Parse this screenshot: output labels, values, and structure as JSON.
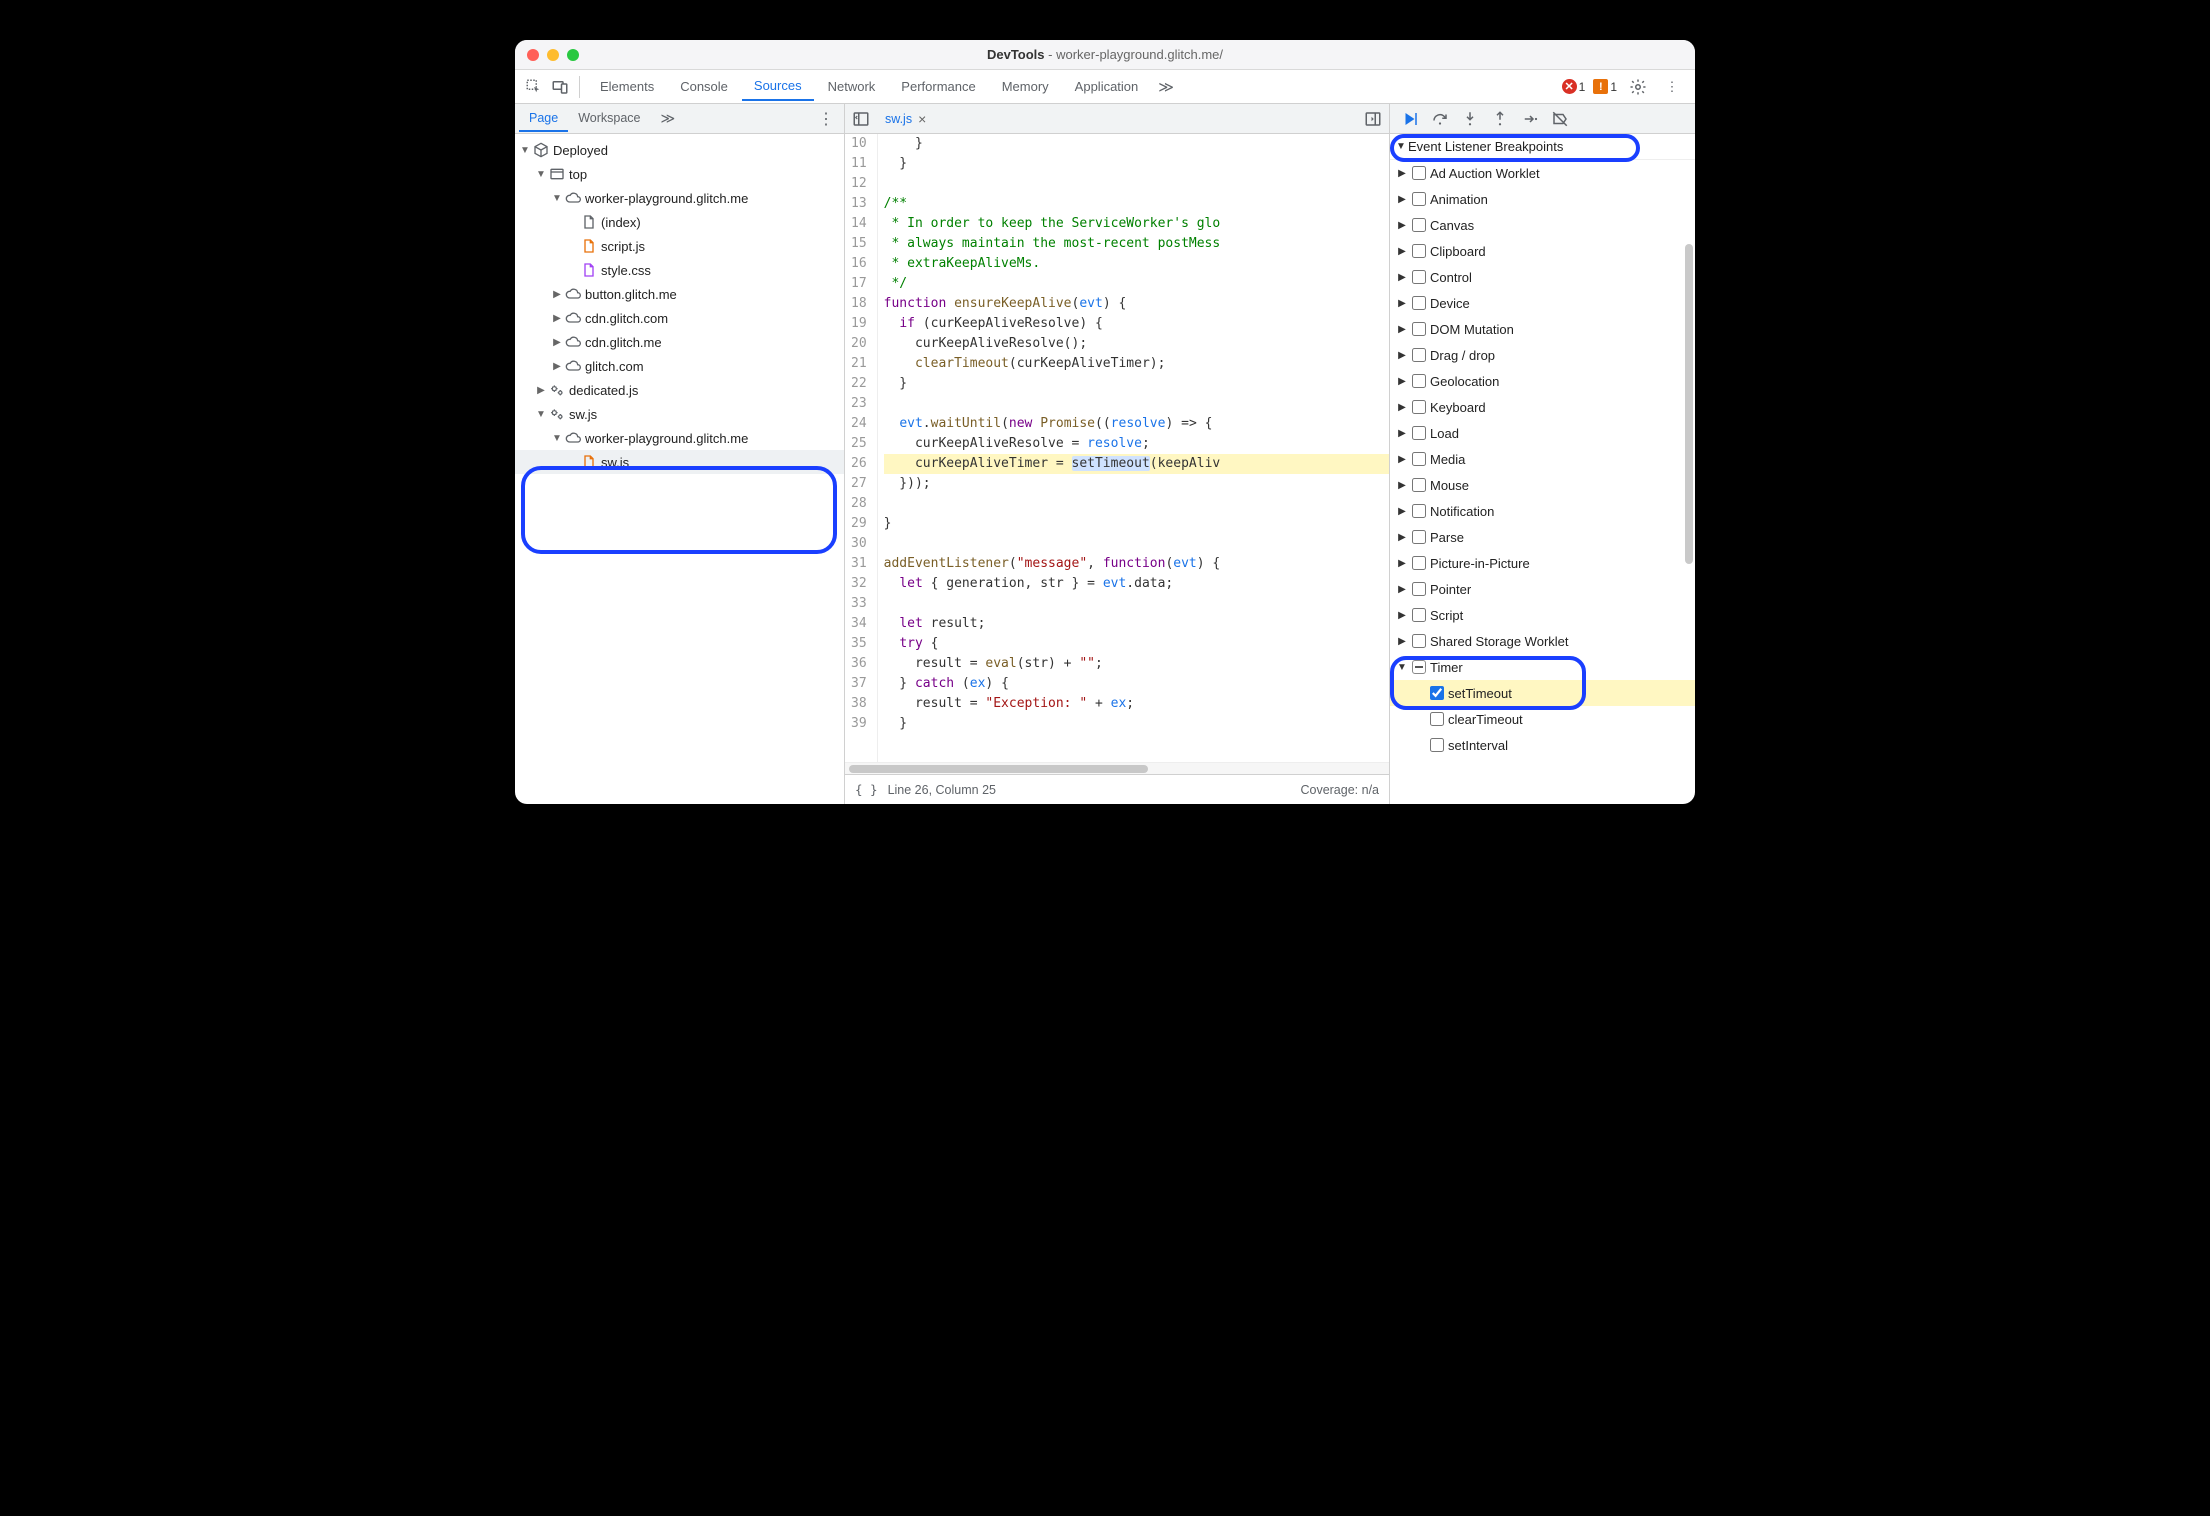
{
  "window": {
    "app": "DevTools",
    "host": "worker-playground.glitch.me/"
  },
  "toolbar": {
    "tabs": [
      "Elements",
      "Console",
      "Sources",
      "Network",
      "Performance",
      "Memory",
      "Application"
    ],
    "active_tab": "Sources",
    "more": "≫",
    "error_count": "1",
    "warn_count": "1"
  },
  "left": {
    "subtabs": [
      "Page",
      "Workspace"
    ],
    "active_subtab": "Page",
    "more": "≫",
    "tree": {
      "root": "Deployed",
      "top": "top",
      "origin_main": "worker-playground.glitch.me",
      "files_main": [
        {
          "name": "(index)",
          "kind": "html"
        },
        {
          "name": "script.js",
          "kind": "js"
        },
        {
          "name": "style.css",
          "kind": "css"
        }
      ],
      "origins_other": [
        "button.glitch.me",
        "cdn.glitch.com",
        "cdn.glitch.me",
        "glitch.com"
      ],
      "dedicated": "dedicated.js",
      "sw_group": "sw.js",
      "sw_origin": "worker-playground.glitch.me",
      "sw_file": "sw.js"
    }
  },
  "editor": {
    "open_file": "sw.js",
    "first_line_no": 10,
    "lines": [
      "    }",
      "  }",
      "",
      "/**",
      " * In order to keep the ServiceWorker's glo",
      " * always maintain the most-recent postMess",
      " * extraKeepAliveMs.",
      " */",
      "function ensureKeepAlive(evt) {",
      "  if (curKeepAliveResolve) {",
      "    curKeepAliveResolve();",
      "    clearTimeout(curKeepAliveTimer);",
      "  }",
      "",
      "  evt.waitUntil(new Promise((resolve) => {",
      "    curKeepAliveResolve = resolve;",
      "    curKeepAliveTimer = setTimeout(keepAliv",
      "  }));",
      "",
      "}",
      "",
      "addEventListener(\"message\", function(evt) {",
      "  let { generation, str } = evt.data;",
      "",
      "  let result;",
      "  try {",
      "    result = eval(str) + \"\";",
      "  } catch (ex) {",
      "    result = \"Exception: \" + ex;",
      "  }"
    ],
    "highlight_line_no": 26
  },
  "status": {
    "line": "Line 26, Column 25",
    "coverage": "Coverage: n/a"
  },
  "debugger": {
    "section_title": "Event Listener Breakpoints",
    "categories": [
      "Ad Auction Worklet",
      "Animation",
      "Canvas",
      "Clipboard",
      "Control",
      "Device",
      "DOM Mutation",
      "Drag / drop",
      "Geolocation",
      "Keyboard",
      "Load",
      "Media",
      "Mouse",
      "Notification",
      "Parse",
      "Picture-in-Picture",
      "Pointer",
      "Script",
      "Shared Storage Worklet"
    ],
    "timer": {
      "label": "Timer",
      "children": [
        {
          "name": "setTimeout",
          "checked": true
        },
        {
          "name": "clearTimeout",
          "checked": false
        },
        {
          "name": "setInterval",
          "checked": false
        }
      ]
    }
  }
}
